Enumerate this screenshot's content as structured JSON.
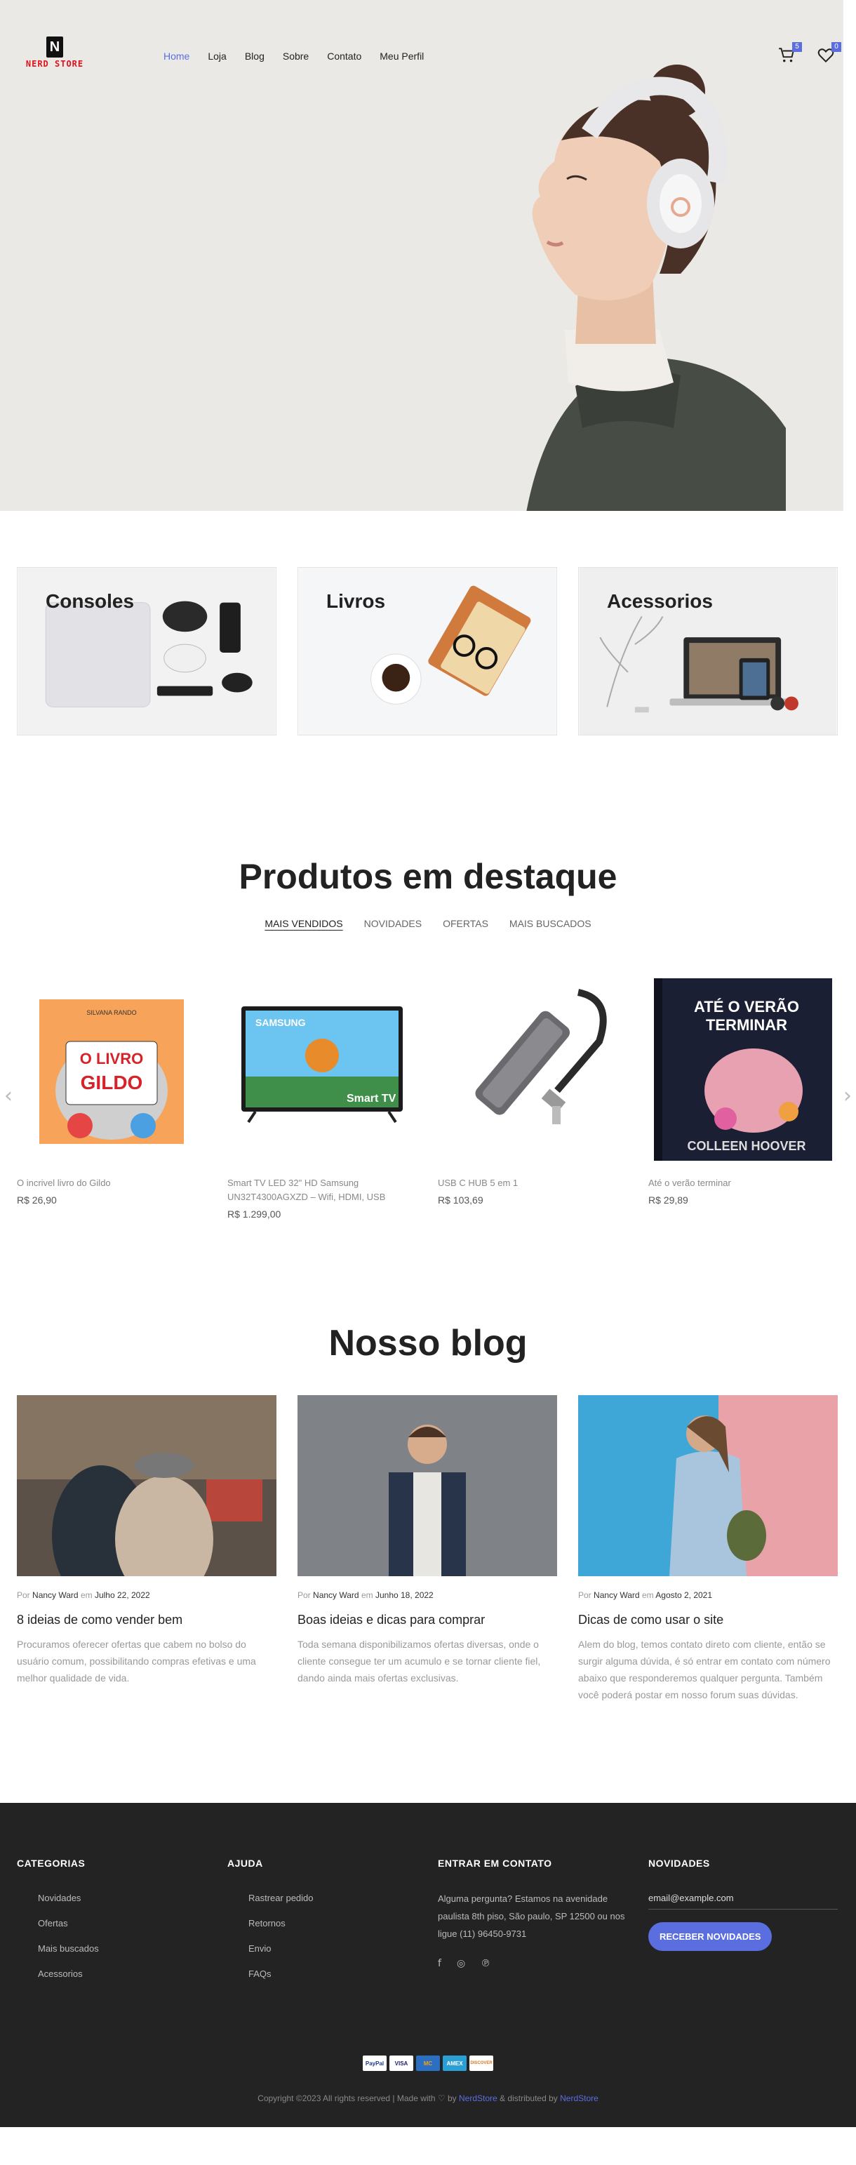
{
  "brand": {
    "logo_letter": "N",
    "logo_text": "NERD STORE"
  },
  "nav": [
    {
      "label": "Home",
      "active": true
    },
    {
      "label": "Loja"
    },
    {
      "label": "Blog"
    },
    {
      "label": "Sobre"
    },
    {
      "label": "Contato"
    },
    {
      "label": "Meu Perfil"
    }
  ],
  "header": {
    "cart_count": "5",
    "wishlist_count": "0",
    "cart_icon": "cart-icon",
    "wishlist_icon": "heart-icon"
  },
  "categories": [
    {
      "title": "Consoles"
    },
    {
      "title": "Livros"
    },
    {
      "title": "Acessorios"
    }
  ],
  "featured": {
    "title": "Produtos em destaque",
    "tabs": [
      "MAIS VENDIDOS",
      "NOVIDADES",
      "OFERTAS",
      "MAIS BUSCADOS"
    ],
    "products": [
      {
        "name": "O incrivel livro do Gildo",
        "price": "R$ 26,90"
      },
      {
        "name": "Smart TV LED 32\" HD Samsung UN32T4300AGXZD – Wifi, HDMI, USB",
        "price": "R$ 1.299,00"
      },
      {
        "name": "USB C HUB 5 em 1",
        "price": "R$ 103,69"
      },
      {
        "name": "Até o verão terminar",
        "price": "R$ 29,89"
      }
    ],
    "prev_icon": "chevron-left-icon",
    "next_icon": "chevron-right-icon"
  },
  "product_art": {
    "gildo_line1": "O LIVRO",
    "gildo_line2": "GILDO",
    "gildo_author": "SILVANA RANDO",
    "tv_brand": "SAMSUNG",
    "tv_label": "Smart TV",
    "book_title_1": "ATÉ O VERÃO",
    "book_title_2": "TERMINAR",
    "book_author": "COLLEEN HOOVER"
  },
  "blog": {
    "title": "Nosso blog",
    "posts": [
      {
        "by": "Por",
        "author": "Nancy Ward",
        "on": "em",
        "date": "Julho 22, 2022",
        "title": "8 ideias de como vender bem",
        "excerpt": "Procuramos oferecer ofertas que cabem no bolso do usuário comum, possibilitando compras efetivas e uma melhor qualidade de vida."
      },
      {
        "by": "Por",
        "author": "Nancy Ward",
        "on": "em",
        "date": "Junho 18, 2022",
        "title": "Boas ideias e dicas para comprar",
        "excerpt": "Toda semana disponibilizamos ofertas diversas, onde o cliente consegue ter um acumulo e se tornar cliente fiel, dando ainda mais ofertas exclusivas."
      },
      {
        "by": "Por",
        "author": "Nancy Ward",
        "on": "em",
        "date": "Agosto 2, 2021",
        "title": "Dicas de como usar o site",
        "excerpt": "Alem do blog, temos contato direto com cliente, então se surgir alguma dúvida, é só entrar em contato com número abaixo que responderemos qualquer pergunta. Também você poderá postar em nosso forum suas dúvidas."
      }
    ]
  },
  "footer": {
    "categories_title": "CATEGORIAS",
    "categories": [
      "Novidades",
      "Ofertas",
      "Mais buscados",
      "Acessorios"
    ],
    "help_title": "AJUDA",
    "help": [
      "Rastrear pedido",
      "Retornos",
      "Envio",
      "FAQs"
    ],
    "contact_title": "ENTRAR EM CONTATO",
    "contact_text": "Alguma pergunta? Estamos na avenidade paulista 8th piso, São paulo, SP 12500 ou nos ligue (11) 96450-9731",
    "social_icons": [
      "facebook-icon",
      "instagram-icon",
      "pinterest-icon"
    ],
    "news_title": "NOVIDADES",
    "email_placeholder": "email@example.com",
    "subscribe_label": "RECEBER NOVIDADES",
    "payments": [
      "PayPal",
      "VISA",
      "MC",
      "AMEX",
      "DISCOVER"
    ],
    "copyright_prefix": "Copyright ©2023 All rights reserved | Made with ♡ by",
    "copyright_brand": "NerdStore",
    "copyright_mid": "& distributed by",
    "copyright_brand2": "NerdStore"
  }
}
